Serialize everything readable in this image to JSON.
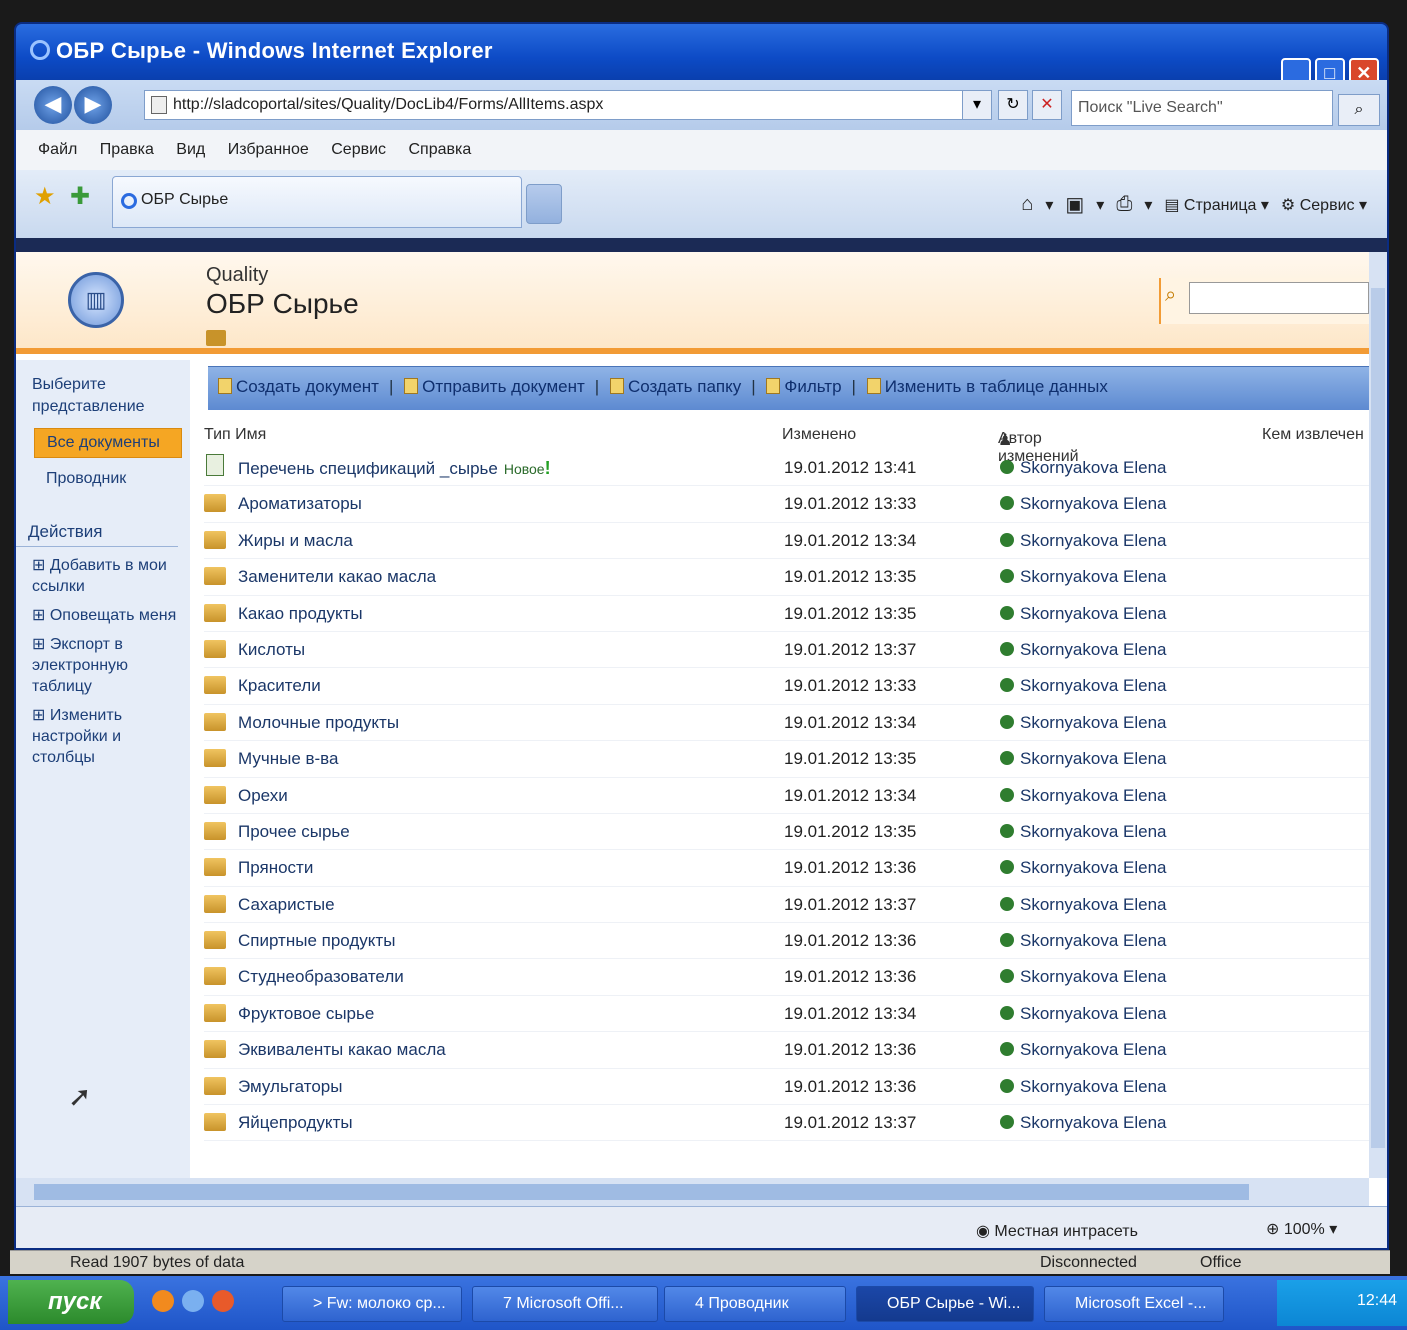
{
  "window": {
    "title": "ОБР Сырье - Windows Internet Explorer",
    "address": "http://sladcoportal/sites/Quality/DocLib4/Forms/AllItems.aspx",
    "search_placeholder": "Поиск \"Live Search\"",
    "menu": [
      "Файл",
      "Правка",
      "Вид",
      "Избранное",
      "Сервис",
      "Справка"
    ],
    "tab_label": "ОБР Сырье",
    "cmd_page": "Страница",
    "cmd_tools": "Сервис"
  },
  "site": {
    "breadcrumb": "Quality",
    "title": "ОБР Сырье"
  },
  "leftnav": {
    "view_header": "Выберите представление",
    "selected_view": "Все документы",
    "explorer_link": "Проводник",
    "actions_header": "Действия",
    "actions": [
      "Добавить в мои ссылки",
      "Оповещать меня",
      "Экспорт в электронную таблицу",
      "Изменить настройки и столбцы"
    ]
  },
  "toolbar": {
    "create_doc": "Создать документ",
    "send_doc": "Отправить документ",
    "create_folder": "Создать папку",
    "filter": "Фильтр",
    "edit_grid": "Изменить в таблице данных"
  },
  "columns": {
    "type_name": "Тип Имя",
    "modified": "Изменено",
    "modified_by": "Автор изменений",
    "checked_out": "Кем извлечен"
  },
  "rows": [
    {
      "name": "Перечень спецификаций _сырье",
      "kind": "document",
      "badge": "Новое",
      "date": "19.01.2012 13:41",
      "author": "Skornyakova Elena"
    },
    {
      "name": "Ароматизаторы",
      "kind": "folder",
      "date": "19.01.2012 13:33",
      "author": "Skornyakova Elena"
    },
    {
      "name": "Жиры и масла",
      "kind": "folder",
      "date": "19.01.2012 13:34",
      "author": "Skornyakova Elena"
    },
    {
      "name": "Заменители какао масла",
      "kind": "folder",
      "date": "19.01.2012 13:35",
      "author": "Skornyakova Elena"
    },
    {
      "name": "Какао продукты",
      "kind": "folder",
      "date": "19.01.2012 13:35",
      "author": "Skornyakova Elena"
    },
    {
      "name": "Кислоты",
      "kind": "folder",
      "date": "19.01.2012 13:37",
      "author": "Skornyakova Elena"
    },
    {
      "name": "Красители",
      "kind": "folder",
      "date": "19.01.2012 13:33",
      "author": "Skornyakova Elena"
    },
    {
      "name": "Молочные продукты",
      "kind": "folder",
      "date": "19.01.2012 13:34",
      "author": "Skornyakova Elena"
    },
    {
      "name": "Мучные в-ва",
      "kind": "folder",
      "date": "19.01.2012 13:35",
      "author": "Skornyakova Elena"
    },
    {
      "name": "Орехи",
      "kind": "folder",
      "date": "19.01.2012 13:34",
      "author": "Skornyakova Elena"
    },
    {
      "name": "Прочее сырье",
      "kind": "folder",
      "date": "19.01.2012 13:35",
      "author": "Skornyakova Elena"
    },
    {
      "name": "Пряности",
      "kind": "folder",
      "date": "19.01.2012 13:36",
      "author": "Skornyakova Elena"
    },
    {
      "name": "Сахаристые",
      "kind": "folder",
      "date": "19.01.2012 13:37",
      "author": "Skornyakova Elena"
    },
    {
      "name": "Спиртные продукты",
      "kind": "folder",
      "date": "19.01.2012 13:36",
      "author": "Skornyakova Elena"
    },
    {
      "name": "Студнеобразователи",
      "kind": "folder",
      "date": "19.01.2012 13:36",
      "author": "Skornyakova Elena"
    },
    {
      "name": "Фруктовое сырье",
      "kind": "folder",
      "date": "19.01.2012 13:34",
      "author": "Skornyakova Elena"
    },
    {
      "name": "Эквиваленты какао масла",
      "kind": "folder",
      "date": "19.01.2012 13:36",
      "author": "Skornyakova Elena"
    },
    {
      "name": "Эмульгаторы",
      "kind": "folder",
      "date": "19.01.2012 13:36",
      "author": "Skornyakova Elena"
    },
    {
      "name": "Яйцепродукты",
      "kind": "folder",
      "date": "19.01.2012 13:37",
      "author": "Skornyakova Elena"
    }
  ],
  "statusbar": {
    "zone": "Местная интрасеть",
    "zoom": "100%"
  },
  "outer_status": {
    "read": "Read 1907 bytes of data",
    "disconnected": "Disconnected",
    "office": "Office"
  },
  "taskbar": {
    "start": "пуск",
    "buttons": [
      "> Fw: молоко ср...",
      "7 Microsoft Offi...",
      "4 Проводник",
      "ОБР Сырье - Wi...",
      "Microsoft Excel -..."
    ],
    "clock": "12:44"
  },
  "colors": {
    "accent_orange": "#f29b35",
    "link_blue": "#1b3768",
    "toolbar_blue": "#5d8ad1",
    "presence_green": "#2f7d2f"
  }
}
